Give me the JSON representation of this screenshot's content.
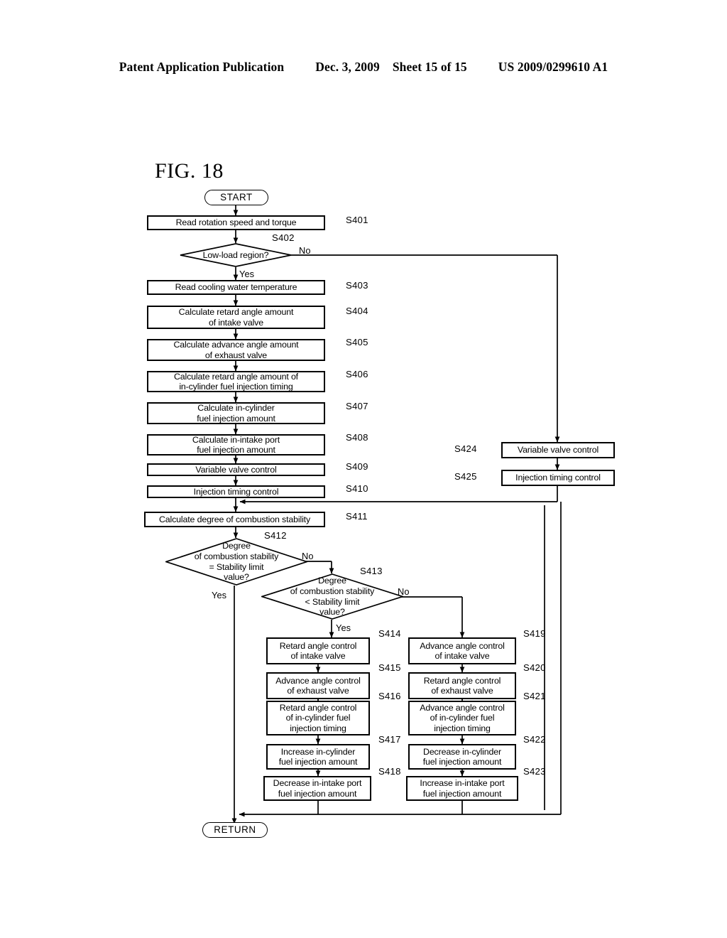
{
  "header": {
    "publication": "Patent Application Publication",
    "date": "Dec. 3, 2009",
    "sheet": "Sheet 15 of 15",
    "number": "US 2009/0299610 A1"
  },
  "figure": {
    "label": "FIG. 18"
  },
  "flowchart": {
    "terminals": {
      "start": "START",
      "return": "RETURN"
    },
    "branch_labels": {
      "s402_no": "No",
      "s402_yes": "Yes",
      "s412_no": "No",
      "s412_yes": "Yes",
      "s413_no": "No",
      "s413_yes": "Yes"
    },
    "steps": [
      {
        "id": "S401",
        "type": "process",
        "text": "Read rotation speed and torque"
      },
      {
        "id": "S402",
        "type": "decision",
        "text": "Low-load region?"
      },
      {
        "id": "S403",
        "type": "process",
        "text": "Read cooling water temperature"
      },
      {
        "id": "S404",
        "type": "process",
        "text": "Calculate retard angle amount\nof intake valve"
      },
      {
        "id": "S405",
        "type": "process",
        "text": "Calculate advance angle amount\nof exhaust valve"
      },
      {
        "id": "S406",
        "type": "process",
        "text": "Calculate retard angle amount of\nin-cylinder fuel injection timing"
      },
      {
        "id": "S407",
        "type": "process",
        "text": "Calculate in-cylinder\nfuel injection amount"
      },
      {
        "id": "S408",
        "type": "process",
        "text": "Calculate in-intake port\nfuel injection amount"
      },
      {
        "id": "S409",
        "type": "process",
        "text": "Variable valve control"
      },
      {
        "id": "S410",
        "type": "process",
        "text": "Injection timing control"
      },
      {
        "id": "S411",
        "type": "process",
        "text": "Calculate degree of combustion stability"
      },
      {
        "id": "S412",
        "type": "decision",
        "text": "Degree\nof combustion stability\n= Stability limit\nvalue?"
      },
      {
        "id": "S413",
        "type": "decision",
        "text": "Degree\nof combustion stability\n< Stability limit\nvalue?"
      },
      {
        "id": "S414",
        "type": "process",
        "text": "Retard angle control\nof intake valve"
      },
      {
        "id": "S415",
        "type": "process",
        "text": "Advance angle control\nof exhaust valve"
      },
      {
        "id": "S416",
        "type": "process",
        "text": "Retard angle control\nof in-cylinder fuel\ninjection timing"
      },
      {
        "id": "S417",
        "type": "process",
        "text": "Increase in-cylinder\nfuel injection amount"
      },
      {
        "id": "S418",
        "type": "process",
        "text": "Decrease in-intake port\nfuel injection amount"
      },
      {
        "id": "S419",
        "type": "process",
        "text": "Advance angle control\nof intake valve"
      },
      {
        "id": "S420",
        "type": "process",
        "text": "Retard angle control\nof exhaust valve"
      },
      {
        "id": "S421",
        "type": "process",
        "text": "Advance angle control\nof in-cylinder fuel\ninjection timing"
      },
      {
        "id": "S422",
        "type": "process",
        "text": "Decrease in-cylinder\nfuel injection amount"
      },
      {
        "id": "S423",
        "type": "process",
        "text": "Increase in-intake port\nfuel injection amount"
      },
      {
        "id": "S424",
        "type": "process",
        "text": "Variable valve control"
      },
      {
        "id": "S425",
        "type": "process",
        "text": "Injection timing control"
      }
    ]
  }
}
